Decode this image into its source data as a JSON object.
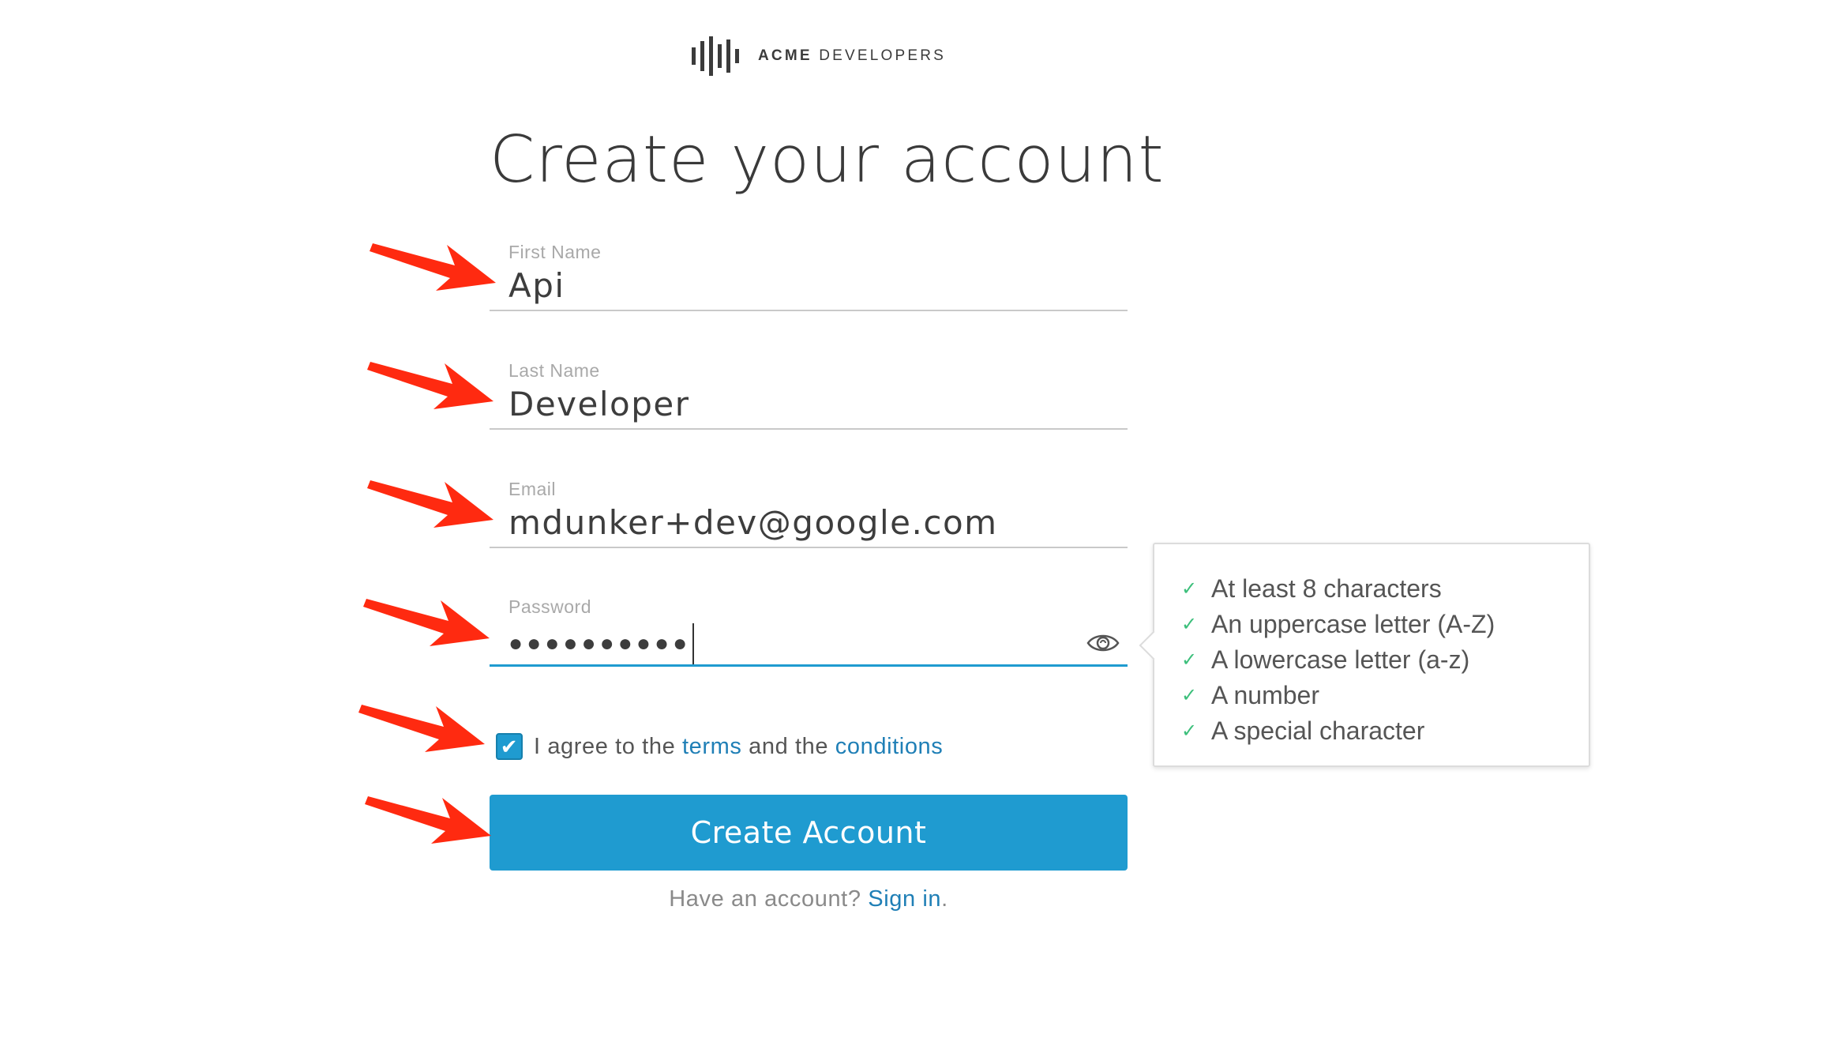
{
  "brand": {
    "logo_icon": "sound-bars-logo-icon",
    "name_bold": "ACME",
    "name_rest": "DEVELOPERS"
  },
  "title": "Create your account",
  "fields": {
    "first_name": {
      "label": "First Name",
      "value": "Api"
    },
    "last_name": {
      "label": "Last Name",
      "value": "Developer"
    },
    "email": {
      "label": "Email",
      "value": "mdunker+dev@google.com"
    },
    "password": {
      "label": "Password",
      "masked_value": "●●●●●●●●●●",
      "toggle_icon": "eye-icon"
    }
  },
  "password_rules": [
    "At least 8 characters",
    "An uppercase letter (A-Z)",
    "A lowercase letter (a-z)",
    "A number",
    "A special character"
  ],
  "agree": {
    "checked": true,
    "prefix": "I agree to the",
    "terms_link": "terms",
    "middle": "and the",
    "conditions_link": "conditions"
  },
  "submit_label": "Create Account",
  "signin": {
    "prompt": "Have an account?",
    "link": "Sign in",
    "suffix": "."
  },
  "colors": {
    "accent": "#1f9bd0",
    "link": "#1f7fb6",
    "check": "#3cbf7b",
    "annotation_arrow": "#ff2a10"
  }
}
